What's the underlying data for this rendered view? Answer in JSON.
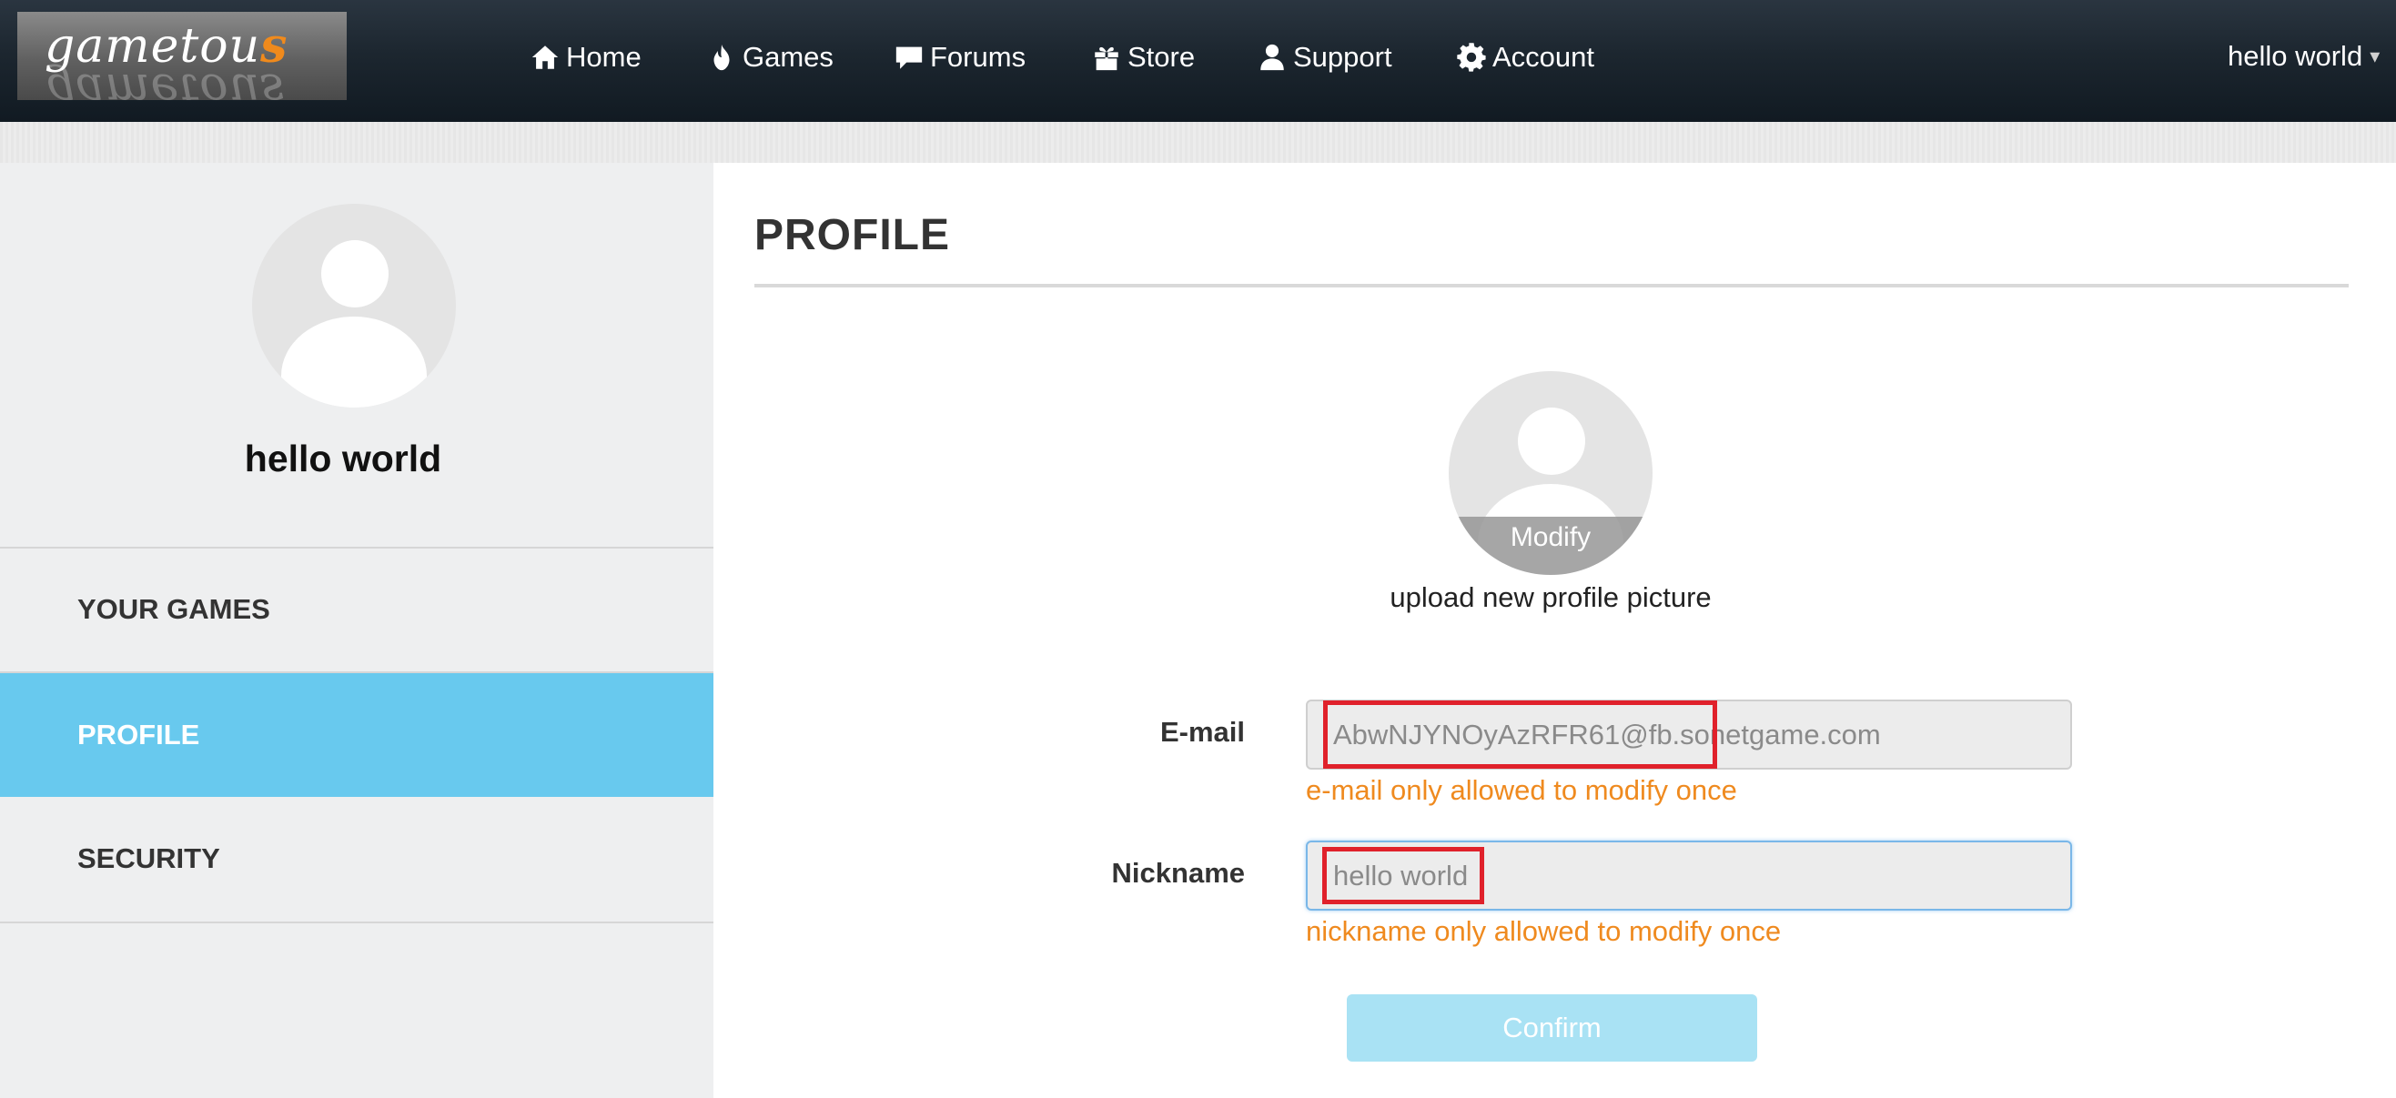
{
  "header": {
    "logo_text": "gametous",
    "nav": [
      {
        "label": "Home",
        "icon": "home-icon"
      },
      {
        "label": "Games",
        "icon": "flame-icon"
      },
      {
        "label": "Forums",
        "icon": "speech-bubble-icon"
      },
      {
        "label": "Store",
        "icon": "gift-icon"
      },
      {
        "label": "Support",
        "icon": "user-icon"
      },
      {
        "label": "Account",
        "icon": "gear-icon"
      }
    ],
    "user_name": "hello world",
    "user_caret": "▾"
  },
  "sidebar": {
    "user_name": "hello world",
    "items": [
      {
        "label": "YOUR GAMES",
        "active": false
      },
      {
        "label": "PROFILE",
        "active": true
      },
      {
        "label": "SECURITY",
        "active": false
      }
    ]
  },
  "main": {
    "title": "PROFILE",
    "picture": {
      "modify_label": "Modify",
      "caption": "upload new profile picture"
    },
    "email": {
      "label": "E-mail",
      "value": "AbwNJYNOyAzRFR61@fb.sonetgame.com",
      "hint": "e-mail only allowed to modify once"
    },
    "nickname": {
      "label": "Nickname",
      "value": "hello world",
      "hint": "nickname only allowed to modify once"
    },
    "confirm_label": "Confirm"
  },
  "colors": {
    "accent": "#68c9ee",
    "hint": "#ef8a1f",
    "highlight_box": "#e0212b",
    "confirm_button": "#a9e2f4",
    "navbar": "#1c262f"
  }
}
